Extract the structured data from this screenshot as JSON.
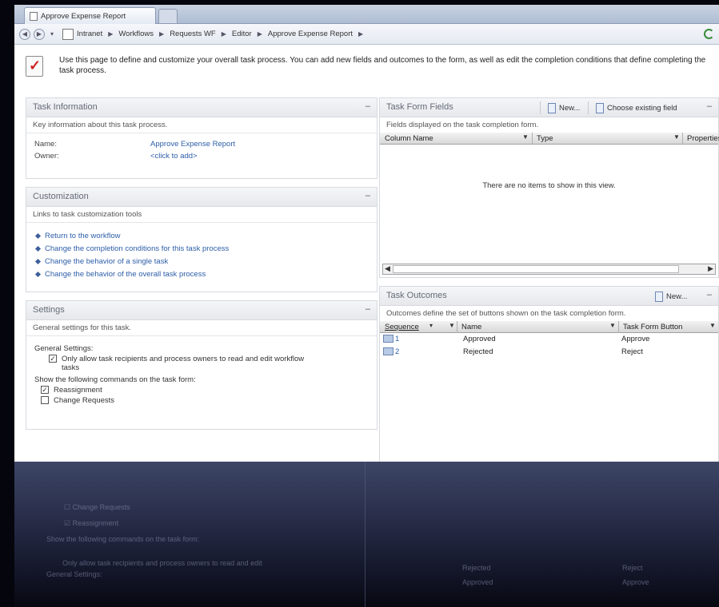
{
  "browser": {
    "tab_title": "Approve Expense Report",
    "breadcrumbs": [
      "Intranet",
      "Workflows",
      "Requests WF",
      "Editor",
      "Approve Expense Report"
    ]
  },
  "intro": {
    "text": "Use this page to define and customize your overall task process. You can add new fields and outcomes to the form, as well as edit the completion conditions that define completing the task process."
  },
  "task_information": {
    "title": "Task Information",
    "description": "Key information about this task process.",
    "name_label": "Name:",
    "name_value": "Approve Expense Report",
    "owner_label": "Owner:",
    "owner_value": "<click to add>"
  },
  "customization": {
    "title": "Customization",
    "description": "Links to task customization tools",
    "links": [
      "Return to the workflow",
      "Change the completion conditions for this task process",
      "Change the behavior of a single task",
      "Change the behavior of the overall task process"
    ]
  },
  "settings": {
    "title": "Settings",
    "description": "General settings for this task.",
    "general_label": "General Settings:",
    "general_option": "Only allow task recipients and process owners to read and edit workflow tasks",
    "commands_label": "Show the following commands on the task form:",
    "reassignment_label": "Reassignment",
    "change_requests_label": "Change Requests",
    "general_checked": true,
    "reassignment_checked": true,
    "change_requests_checked": false
  },
  "task_form_fields": {
    "title": "Task Form Fields",
    "new_label": "New...",
    "choose_label": "Choose existing field",
    "description": "Fields displayed on the task completion form.",
    "columns": [
      "Column Name",
      "Type",
      "Properties"
    ],
    "empty_message": "There are no items to show in this view."
  },
  "task_outcomes": {
    "title": "Task Outcomes",
    "new_label": "New...",
    "description": "Outcomes define the set of buttons shown on the task completion form.",
    "columns": [
      "Sequence",
      "Name",
      "Task Form Button"
    ],
    "rows": [
      {
        "sequence": "1",
        "name": "Approved",
        "button": "Approve"
      },
      {
        "sequence": "2",
        "name": "Rejected",
        "button": "Reject"
      }
    ]
  }
}
